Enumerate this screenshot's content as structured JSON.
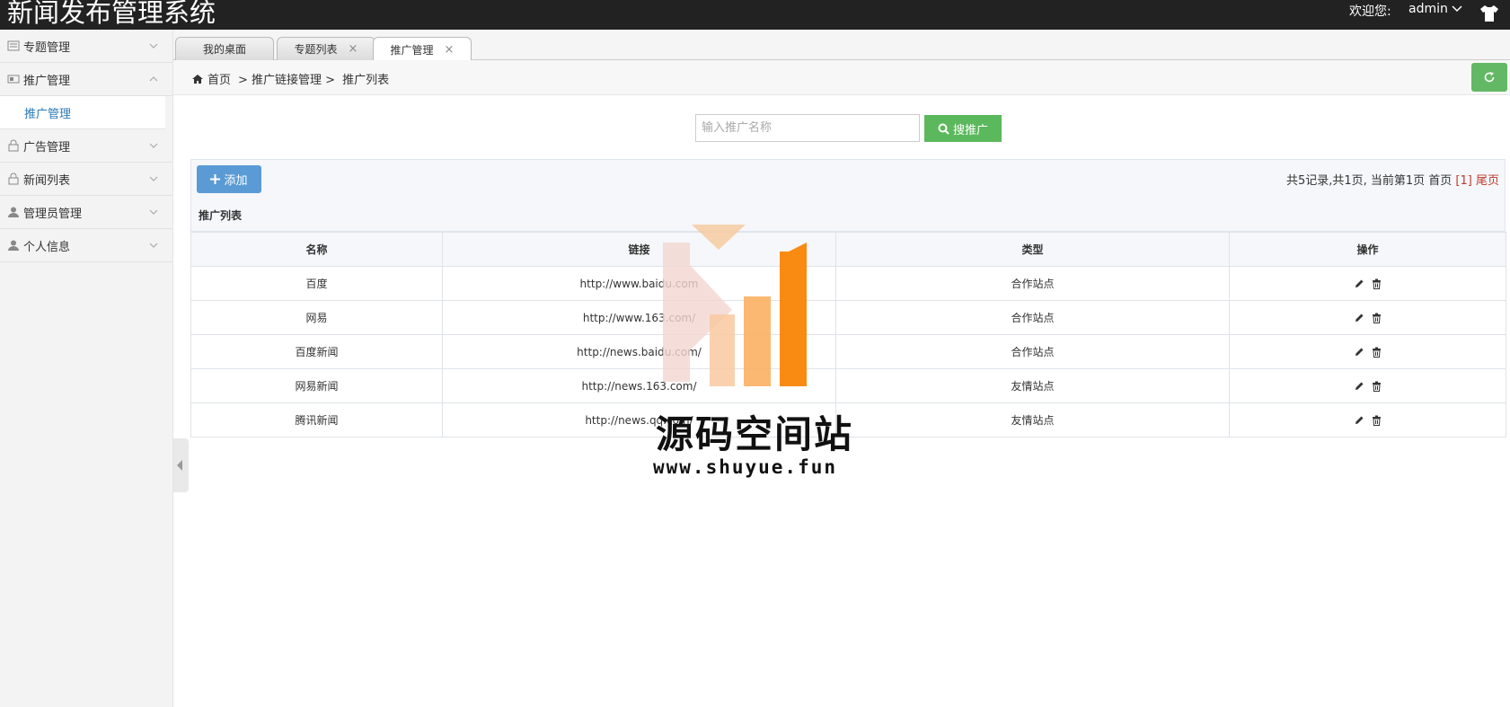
{
  "header": {
    "app_title": "新闻发布管理系统",
    "welcome": "欢迎您:",
    "username": "admin"
  },
  "sidebar": {
    "items": [
      {
        "label": "专题管理",
        "icon": "list-icon",
        "expanded": false
      },
      {
        "label": "推广管理",
        "icon": "card-icon",
        "expanded": true,
        "sub": "推广管理"
      },
      {
        "label": "广告管理",
        "icon": "lock-icon",
        "expanded": false
      },
      {
        "label": "新闻列表",
        "icon": "lock-icon",
        "expanded": false
      },
      {
        "label": "管理员管理",
        "icon": "user-icon",
        "expanded": false
      },
      {
        "label": "个人信息",
        "icon": "user-icon",
        "expanded": false
      }
    ]
  },
  "tabs": [
    {
      "label": "我的桌面",
      "closable": false
    },
    {
      "label": "专题列表",
      "closable": true
    },
    {
      "label": "推广管理",
      "closable": true,
      "active": true
    }
  ],
  "breadcrumb": {
    "home": "首页",
    "level1": "> 推广链接管理 >",
    "level2": "推广列表"
  },
  "search": {
    "placeholder": "输入推广名称",
    "value": "",
    "button": "搜推广"
  },
  "toolbar": {
    "add_label": "添加",
    "pager_text": "共5记录,共1页, 当前第1页 首页 ",
    "pager_current": "[1]",
    "pager_last": "尾页"
  },
  "table": {
    "title": "推广列表",
    "columns": [
      "名称",
      "链接",
      "类型",
      "操作"
    ],
    "rows": [
      {
        "name": "百度",
        "link": "http://www.baidu.com",
        "type": "合作站点"
      },
      {
        "name": "网易",
        "link": "http://www.163.com/",
        "type": "合作站点"
      },
      {
        "name": "百度新闻",
        "link": "http://news.baidu.com/",
        "type": "合作站点"
      },
      {
        "name": "网易新闻",
        "link": "http://news.163.com/",
        "type": "友情站点"
      },
      {
        "name": "腾讯新闻",
        "link": "http://news.qq.com/",
        "type": "友情站点"
      }
    ]
  },
  "watermark": {
    "text": "源码空间站",
    "url": "www.shuyue.fun"
  },
  "colors": {
    "topbar": "#222222",
    "accent_green": "#5cb85c",
    "accent_blue": "#5a9bd5",
    "active_link": "#2b7ab6",
    "pager_red": "#c0392b"
  }
}
